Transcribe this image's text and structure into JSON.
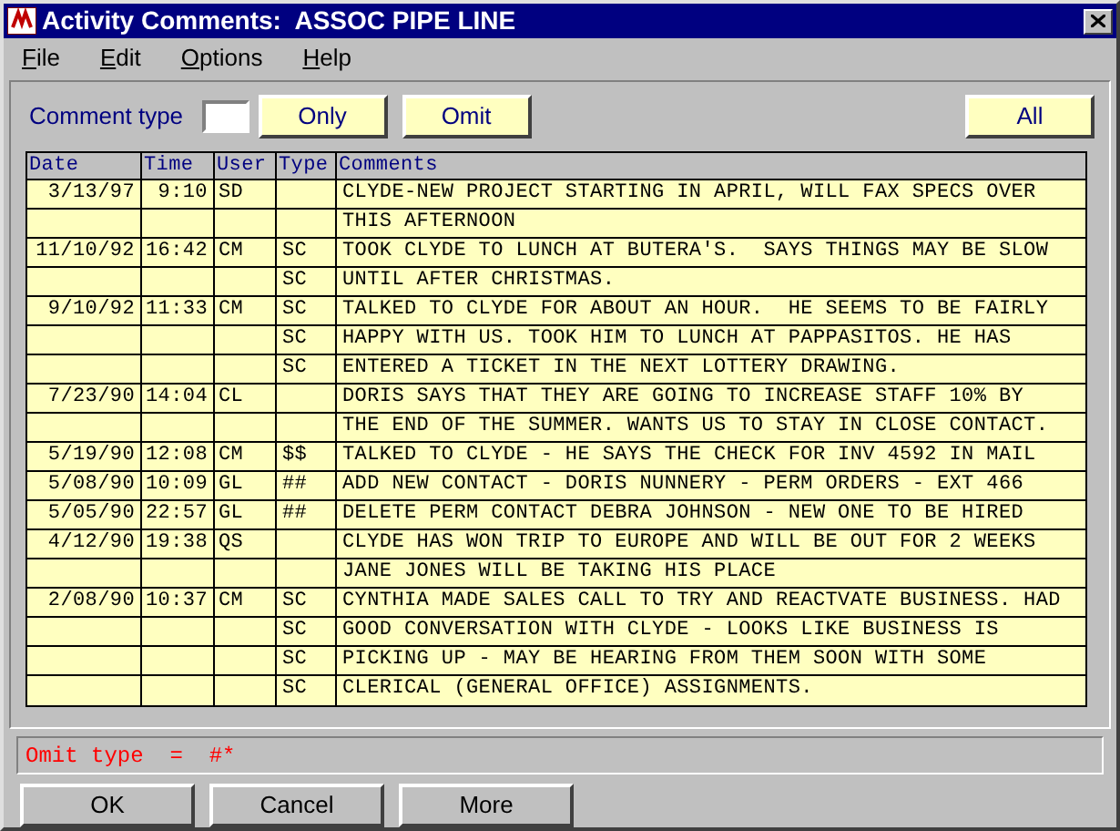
{
  "window": {
    "title": "Activity Comments:  ASSOC PIPE LINE"
  },
  "menu": [
    "File",
    "Edit",
    "Options",
    "Help"
  ],
  "filter": {
    "label": "Comment type",
    "buttons": [
      "Only",
      "Omit"
    ],
    "all_button": "All"
  },
  "table": {
    "columns": [
      "Date",
      "Time",
      "User",
      "Type",
      "Comments"
    ],
    "rows": [
      [
        "3/13/97",
        "9:10",
        "SD",
        "",
        "CLYDE-NEW PROJECT STARTING IN APRIL, WILL FAX SPECS OVER"
      ],
      [
        "",
        "",
        "",
        "",
        "THIS AFTERNOON"
      ],
      [
        "11/10/92",
        "16:42",
        "CM",
        "SC",
        "TOOK CLYDE TO LUNCH AT BUTERA'S.  SAYS THINGS MAY BE SLOW"
      ],
      [
        "",
        "",
        "",
        "SC",
        "UNTIL AFTER CHRISTMAS."
      ],
      [
        "9/10/92",
        "11:33",
        "CM",
        "SC",
        "TALKED TO CLYDE FOR ABOUT AN HOUR.  HE SEEMS TO BE FAIRLY"
      ],
      [
        "",
        "",
        "",
        "SC",
        "HAPPY WITH US. TOOK HIM TO LUNCH AT PAPPASITOS. HE HAS"
      ],
      [
        "",
        "",
        "",
        "SC",
        "ENTERED A TICKET IN THE NEXT LOTTERY DRAWING."
      ],
      [
        "7/23/90",
        "14:04",
        "CL",
        "",
        "DORIS SAYS THAT THEY ARE GOING TO INCREASE STAFF 10% BY"
      ],
      [
        "",
        "",
        "",
        "",
        "THE END OF THE SUMMER. WANTS US TO STAY IN CLOSE CONTACT."
      ],
      [
        "5/19/90",
        "12:08",
        "CM",
        "$$",
        "TALKED TO CLYDE - HE SAYS THE CHECK FOR INV 4592 IN MAIL"
      ],
      [
        "5/08/90",
        "10:09",
        "GL",
        "##",
        "ADD NEW CONTACT - DORIS NUNNERY - PERM ORDERS - EXT 466"
      ],
      [
        "5/05/90",
        "22:57",
        "GL",
        "##",
        "DELETE PERM CONTACT DEBRA JOHNSON - NEW ONE TO BE HIRED"
      ],
      [
        "4/12/90",
        "19:38",
        "QS",
        "",
        "CLYDE HAS WON TRIP TO EUROPE AND WILL BE OUT FOR 2 WEEKS"
      ],
      [
        "",
        "",
        "",
        "",
        "JANE JONES WILL BE TAKING HIS PLACE"
      ],
      [
        "2/08/90",
        "10:37",
        "CM",
        "SC",
        "CYNTHIA MADE SALES CALL TO TRY AND REACTVATE BUSINESS. HAD"
      ],
      [
        "",
        "",
        "",
        "SC",
        "GOOD CONVERSATION WITH CLYDE - LOOKS LIKE BUSINESS IS"
      ],
      [
        "",
        "",
        "",
        "SC",
        "PICKING UP - MAY BE HEARING FROM THEM SOON WITH SOME"
      ],
      [
        "",
        "",
        "",
        "SC",
        "CLERICAL (GENERAL OFFICE) ASSIGNMENTS."
      ]
    ]
  },
  "status": "Omit type  =  #*",
  "buttons": [
    "OK",
    "Cancel",
    "More"
  ]
}
